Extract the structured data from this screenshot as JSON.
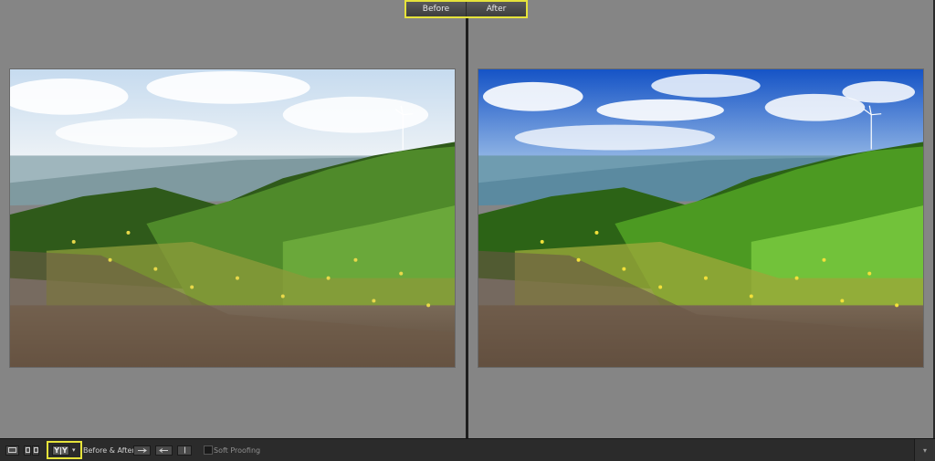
{
  "compare": {
    "before_tab": "Before",
    "after_tab": "After"
  },
  "toolbar": {
    "loupe_icon": "loupe-view-icon",
    "compare_icon": "compare-view-icon",
    "yy_label": "Y|Y",
    "yy_dropdown_icon": "chevron-down-icon",
    "before_after_label": "Before & After :",
    "swap_icons": [
      "copy-before-to-after-icon",
      "copy-after-to-before-icon",
      "swap-before-after-icon"
    ],
    "soft_proofing_label": "Soft Proofing",
    "soft_proofing_checked": false,
    "expand_icon": "chevron-down-icon"
  },
  "photos": {
    "before": {
      "sky_top": "#c9dcef",
      "sky_bottom": "#eef3f7",
      "hill": "#3f6b22",
      "ground": "#6e5a4a"
    },
    "after": {
      "sky_top": "#1a58c9",
      "sky_bottom": "#8fb6e6",
      "hill": "#3d7a18",
      "ground": "#6a5648"
    }
  }
}
